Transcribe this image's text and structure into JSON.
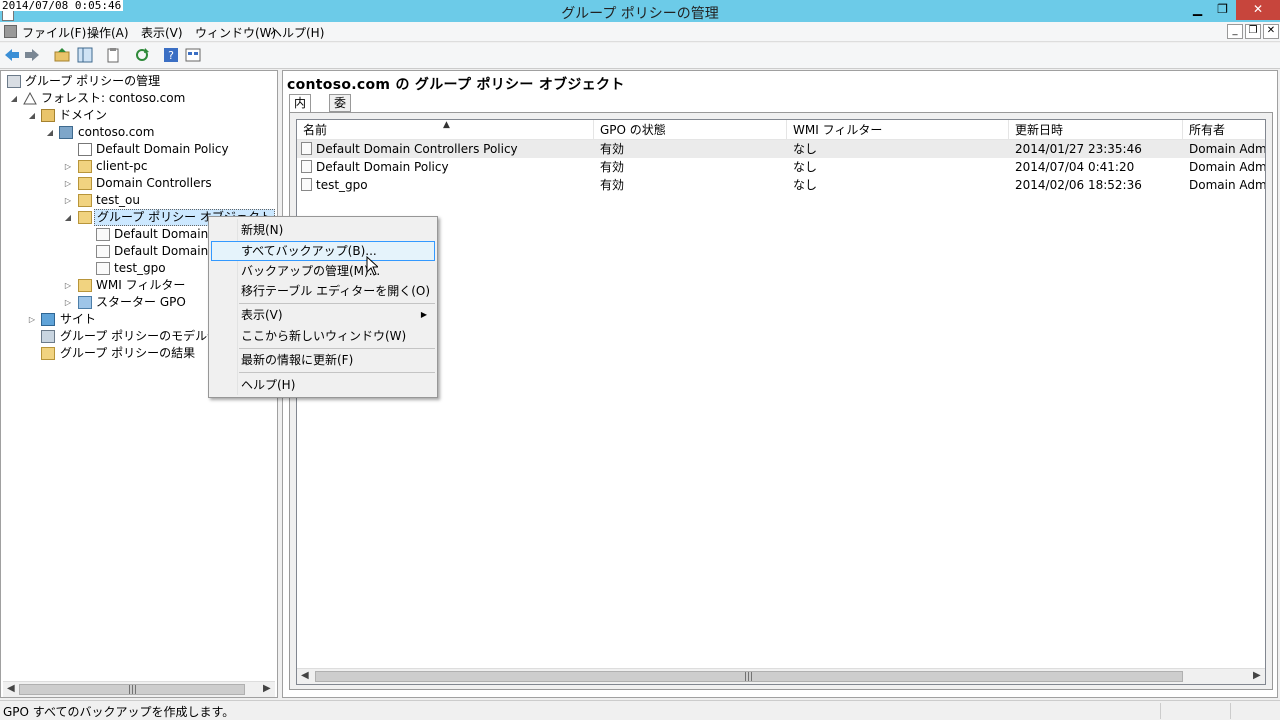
{
  "window": {
    "timestamp": "2014/07/08 0:05:46",
    "title": "グループ ポリシーの管理",
    "minimize": "▁",
    "restore": "❐",
    "close": "✕"
  },
  "menubar": {
    "items": [
      "ファイル(F)",
      "操作(A)",
      "表示(V)",
      "ウィンドウ(W)",
      "ヘルプ(H)"
    ],
    "mdi_min": "_",
    "mdi_restore": "❐",
    "mdi_close": "✕"
  },
  "toolbar": {
    "icons": [
      "back-icon",
      "forward-icon",
      "up-folder-icon",
      "show-hide-tree-icon",
      "copy-icon",
      "refresh-icon",
      "help-icon",
      "view-icon"
    ]
  },
  "tree": {
    "root": "グループ ポリシーの管理",
    "forest": "フォレスト: contoso.com",
    "domains": "ドメイン",
    "domain": "contoso.com",
    "default_domain_policy": "Default Domain Policy",
    "client_pc": "client-pc",
    "domain_controllers": "Domain Controllers",
    "test_ou": "test_ou",
    "gpo_container": "グループ ポリシー オブジェクト",
    "gpo1": "Default Domain C",
    "gpo2": "Default Domain P",
    "gpo3": "test_gpo",
    "wmi": "WMI フィルター",
    "starter": "スターター GPO",
    "sites": "サイト",
    "modeling": "グループ ポリシーのモデル作成",
    "results": "グループ ポリシーの結果"
  },
  "right": {
    "title": "contoso.com の グループ ポリシー オブジェクト",
    "tabs": [
      "内容",
      "委任"
    ],
    "columns": [
      "名前",
      "GPO の状態",
      "WMI フィルター",
      "更新日時",
      "所有者"
    ],
    "rows": [
      [
        "Default Domain Controllers Policy",
        "有効",
        "なし",
        "2014/01/27 23:35:46",
        "Domain Admir"
      ],
      [
        "Default Domain Policy",
        "有効",
        "なし",
        "2014/07/04 0:41:20",
        "Domain Admir"
      ],
      [
        "test_gpo",
        "有効",
        "なし",
        "2014/02/06 18:52:36",
        "Domain Admir"
      ]
    ]
  },
  "context_menu": {
    "new": "新規(N)",
    "backup_all": "すべてバックアップ(B)...",
    "manage_backups": "バックアップの管理(M)...",
    "migration_editor": "移行テーブル エディターを開く(O)",
    "view": "表示(V)",
    "new_window": "ここから新しいウィンドウ(W)",
    "refresh": "最新の情報に更新(F)",
    "help": "ヘルプ(H)"
  },
  "status": {
    "text": "GPO すべてのバックアップを作成します。"
  }
}
